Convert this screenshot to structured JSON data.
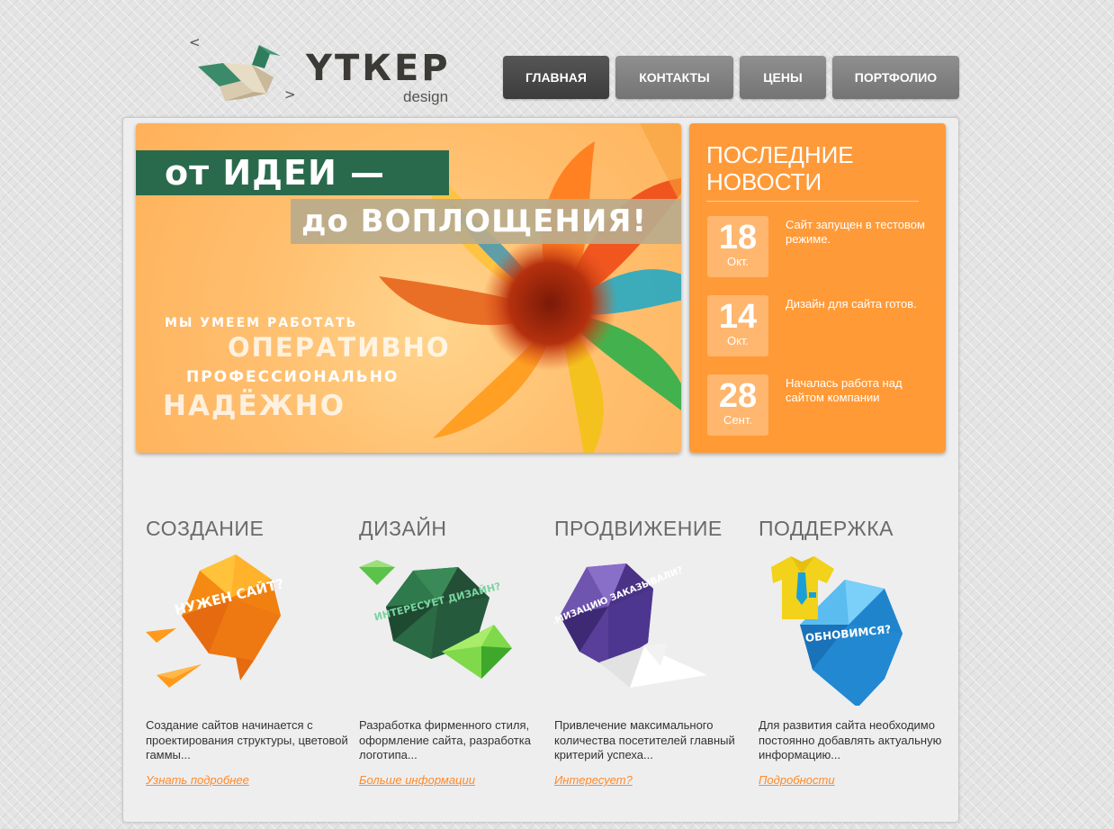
{
  "logo": {
    "wordmark": "ΥТКЕР",
    "sub": "design",
    "arrow_left": "<",
    "arrow_right": ">"
  },
  "nav": [
    {
      "label": "ГЛАВНАЯ",
      "active": true
    },
    {
      "label": "КОНТАКТЫ",
      "active": false
    },
    {
      "label": "ЦЕНЫ",
      "active": false
    },
    {
      "label": "ПОРТФОЛИО",
      "active": false
    }
  ],
  "banner": {
    "headline1": "от ИДЕИ  —",
    "headline2": "до ВОПЛОЩЕНИЯ!",
    "tag1": "МЫ УМЕЕМ РАБОТАТЬ",
    "tag2": "ОПЕРАТИВНО",
    "tag3": "ПРОФЕССИОНАЛЬНО",
    "tag4": "НАДЁЖНО"
  },
  "news": {
    "title": "ПОСЛЕДНИЕ НОВОСТИ",
    "items": [
      {
        "day": "18",
        "month": "Окт.",
        "text": "Сайт запущен в тестовом режиме."
      },
      {
        "day": "14",
        "month": "Окт.",
        "text": "Дизайн для сайта готов."
      },
      {
        "day": "28",
        "month": "Сент.",
        "text": "Началась работа над сайтом компании"
      }
    ]
  },
  "features": [
    {
      "title": "СОЗДАНИЕ",
      "badge": "НУЖЕН САЙТ?",
      "text": "Создание сайтов начинается с проектирования структуры, цветовой гаммы...",
      "link": "Узнать подробнее"
    },
    {
      "title": "ДИЗАЙН",
      "badge": "ИНТЕРЕСУЕТ ДИЗАЙН?",
      "text": "Разработка фирменного стиля, оформление сайта, разработка логотипа...",
      "link": "Больше информации"
    },
    {
      "title": "ПРОДВИЖЕНИЕ",
      "badge": "ОПТИМИЗАЦИЮ ЗАКАЗЫВАЛИ?",
      "text": "Привлечение максимального количества посетителей главный критерий успеха...",
      "link": "Интересует?"
    },
    {
      "title": "ПОДДЕРЖКА",
      "badge": "ОБНОВИМСЯ?",
      "text": "Для развития сайта необходимо постоянно добавлять актуальную информацию...",
      "link": "Подробности"
    }
  ],
  "colors": {
    "accent_orange": "#ff9a3a",
    "link_orange": "#ff8a2a",
    "banner_green": "#2a6a4c",
    "nav_active": "#474747",
    "nav_default": "#828282"
  }
}
